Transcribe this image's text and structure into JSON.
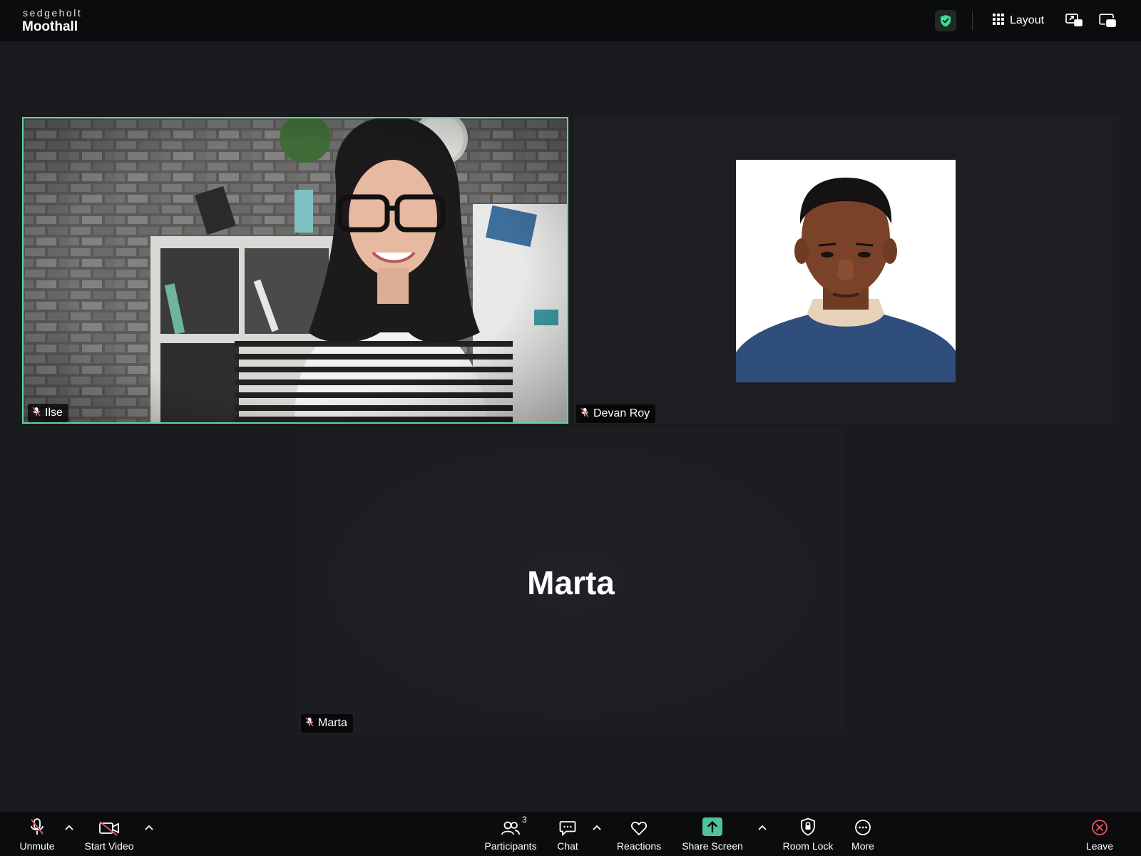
{
  "app": {
    "org": "sedgeholt",
    "room": "Moothall"
  },
  "topbar": {
    "layout_label": "Layout",
    "security_icon": "shield-check-icon",
    "shield_color": "#3ddc97"
  },
  "participants": [
    {
      "name": "Ilse",
      "muted": true,
      "video": "on",
      "active_speaker": true
    },
    {
      "name": "Devan Roy",
      "muted": true,
      "video": "photo"
    },
    {
      "name": "Marta",
      "muted": true,
      "video": "off",
      "placeholder_name": "Marta"
    }
  ],
  "toolbar": {
    "unmute_label": "Unmute",
    "start_video_label": "Start Video",
    "participants_label": "Participants",
    "participants_count": "3",
    "chat_label": "Chat",
    "reactions_label": "Reactions",
    "share_screen_label": "Share Screen",
    "room_lock_label": "Room Lock",
    "more_label": "More",
    "leave_label": "Leave"
  },
  "colors": {
    "accent": "#5fd4a6",
    "share_green": "#4fc39a",
    "danger": "#e0575f",
    "background": "#1a1b1e",
    "bar": "#0b0c0e"
  }
}
